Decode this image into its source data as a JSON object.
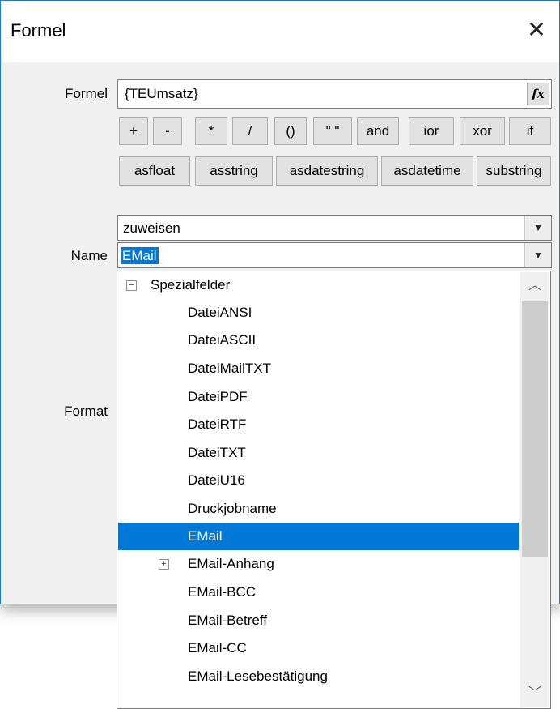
{
  "window": {
    "title": "Formel",
    "close_glyph": "✕"
  },
  "labels": {
    "formel": "Formel",
    "name": "Name",
    "format": "Format"
  },
  "formel_field": {
    "value": "{TEUmsatz}",
    "fx_label": "fx"
  },
  "operator_buttons": [
    "+",
    "-",
    "*",
    "/",
    "()",
    "\" \"",
    "and",
    "ior",
    "xor",
    "if"
  ],
  "function_buttons": [
    "asfloat",
    "asstring",
    "asdatestring",
    "asdatetime",
    "substring"
  ],
  "assign_combo": {
    "value": "zuweisen"
  },
  "name_combo": {
    "value": "EMail"
  },
  "tree": {
    "group": {
      "label": "Spezialfelder",
      "expander": "−"
    },
    "items": [
      {
        "label": "DateiANSI"
      },
      {
        "label": "DateiASCII"
      },
      {
        "label": "DateiMailTXT"
      },
      {
        "label": "DateiPDF"
      },
      {
        "label": "DateiRTF"
      },
      {
        "label": "DateiTXT"
      },
      {
        "label": "DateiU16"
      },
      {
        "label": "Druckjobname"
      },
      {
        "label": "EMail",
        "selected": true
      },
      {
        "label": "EMail-Anhang",
        "expander": "+"
      },
      {
        "label": "EMail-BCC"
      },
      {
        "label": "EMail-Betreff"
      },
      {
        "label": "EMail-CC"
      },
      {
        "label": "EMail-Lesebestätigung"
      }
    ]
  },
  "colors": {
    "selection": "#0078d7",
    "window_border": "#1c7ad4",
    "dialog_bg": "#f0f0f0"
  },
  "icons": {
    "dropdown": "chevron-down-icon",
    "scroll_up": "chevron-up-icon",
    "scroll_down": "chevron-down-icon"
  }
}
